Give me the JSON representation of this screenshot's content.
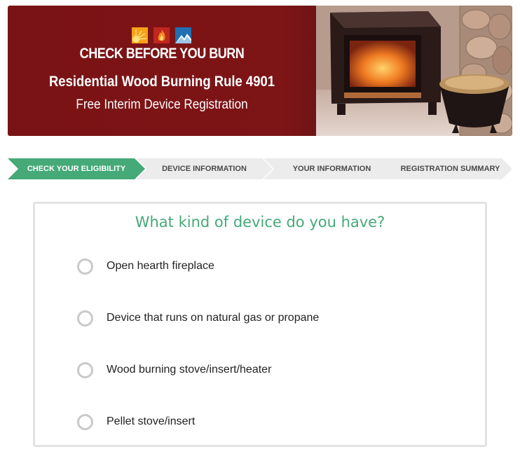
{
  "banner": {
    "brand": "CHECK BEFORE YOU BURN",
    "title": "Residential Wood Burning Rule 4901",
    "subtitle": "Free Interim Device Registration",
    "logo_icons": [
      "sun-icon",
      "flame-icon",
      "mountain-icon"
    ],
    "colors": {
      "background": "#7d1416",
      "text": "#ffffff",
      "logo_sun": "#f6a11a",
      "logo_flame": "#c0271e",
      "logo_mountain": "#1f6fb2"
    }
  },
  "steps": [
    {
      "label": "CHECK YOUR ELIGIBILITY",
      "active": true
    },
    {
      "label": "DEVICE INFORMATION",
      "active": false
    },
    {
      "label": "YOUR INFORMATION",
      "active": false
    },
    {
      "label": "REGISTRATION SUMMARY",
      "active": false
    }
  ],
  "question": {
    "title": "What kind of device do you have?",
    "options": [
      {
        "label": "Open hearth fireplace",
        "selected": false
      },
      {
        "label": "Device that runs on natural gas or propane",
        "selected": false
      },
      {
        "label": "Wood burning stove/insert/heater",
        "selected": false
      },
      {
        "label": "Pellet stove/insert",
        "selected": false
      }
    ]
  },
  "colors": {
    "accent": "#45a978",
    "inactive_step": "#ececec",
    "card_border": "#e3e3e3"
  }
}
